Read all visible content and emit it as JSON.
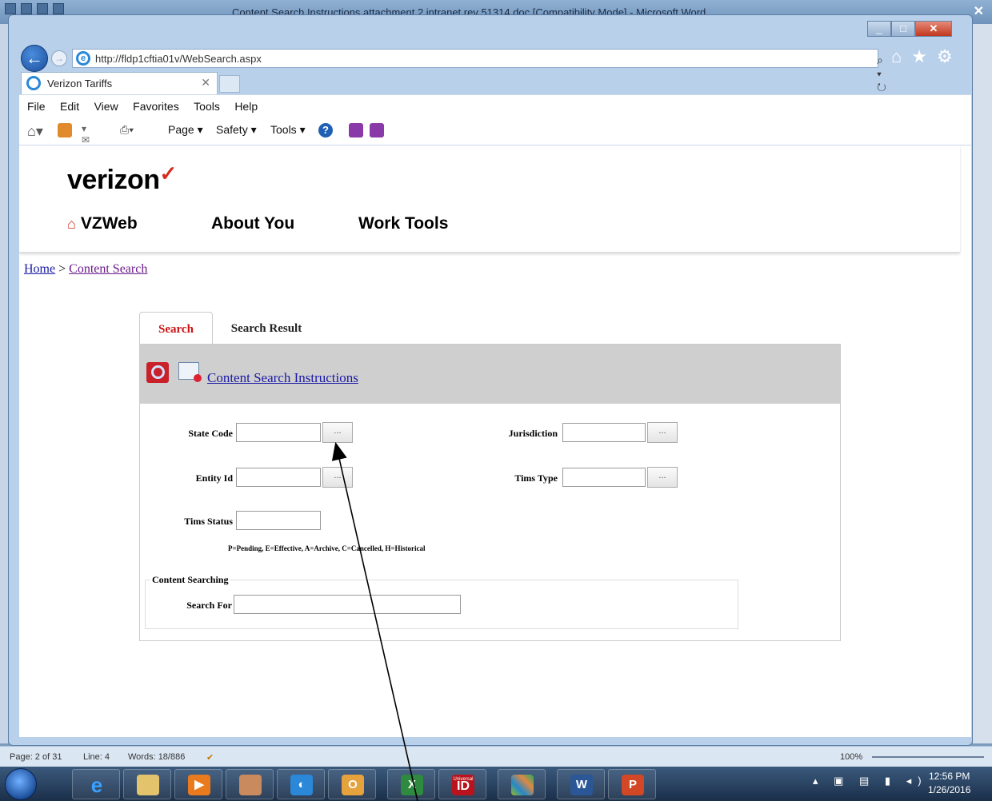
{
  "word": {
    "title": "Content Search Instructions attachment 2 intranet rev 51314.doc [Compatibility Mode] - Microsoft Word",
    "status": {
      "page": "Page: 2 of 31",
      "line": "Line: 4",
      "words": "Words: 18/886",
      "zoom": "100%"
    }
  },
  "browser": {
    "url": "http://fldp1cftia01v/WebSearch.aspx",
    "tab_title": "Verizon Tariffs",
    "menu": [
      "File",
      "Edit",
      "View",
      "Favorites",
      "Tools",
      "Help"
    ],
    "commands": {
      "page": "Page ▾",
      "safety": "Safety ▾",
      "tools": "Tools ▾"
    }
  },
  "site": {
    "logo": "verizon",
    "logo_mark": "✓",
    "nav": [
      "VZWeb",
      "About You",
      "Work Tools"
    ],
    "breadcrumb": {
      "home": "Home",
      "separator": ">",
      "current": "Content Search"
    }
  },
  "search": {
    "tabs": [
      "Search",
      "Search Result"
    ],
    "instructions_link": "Content Search Instructions",
    "fields": {
      "state_code": "State Code",
      "jurisdiction": "Jurisdiction",
      "entity_id": "Entity Id",
      "tims_type": "Tims Type",
      "tims_status": "Tims Status",
      "search_for": "Search For"
    },
    "picker_label": "...",
    "status_help": "P=Pending, E=Effective, A=Archive, C=Cancelled, H=Historical",
    "content_legend": "Content Searching"
  },
  "taskbar": {
    "time": "12:56 PM",
    "date": "1/26/2016",
    "apps": [
      "ie",
      "explorer",
      "media",
      "paint",
      "lync",
      "outlook",
      "excel",
      "universal-id",
      "game",
      "word",
      "powerpoint"
    ],
    "universal_id_top": "Universal",
    "universal_id_label": "ID"
  },
  "colors": {
    "brand_red": "#d52b1e",
    "link_blue": "#1a1aa6",
    "tab_active_red": "#cc1111",
    "panel_header": "#cfcfcf"
  }
}
